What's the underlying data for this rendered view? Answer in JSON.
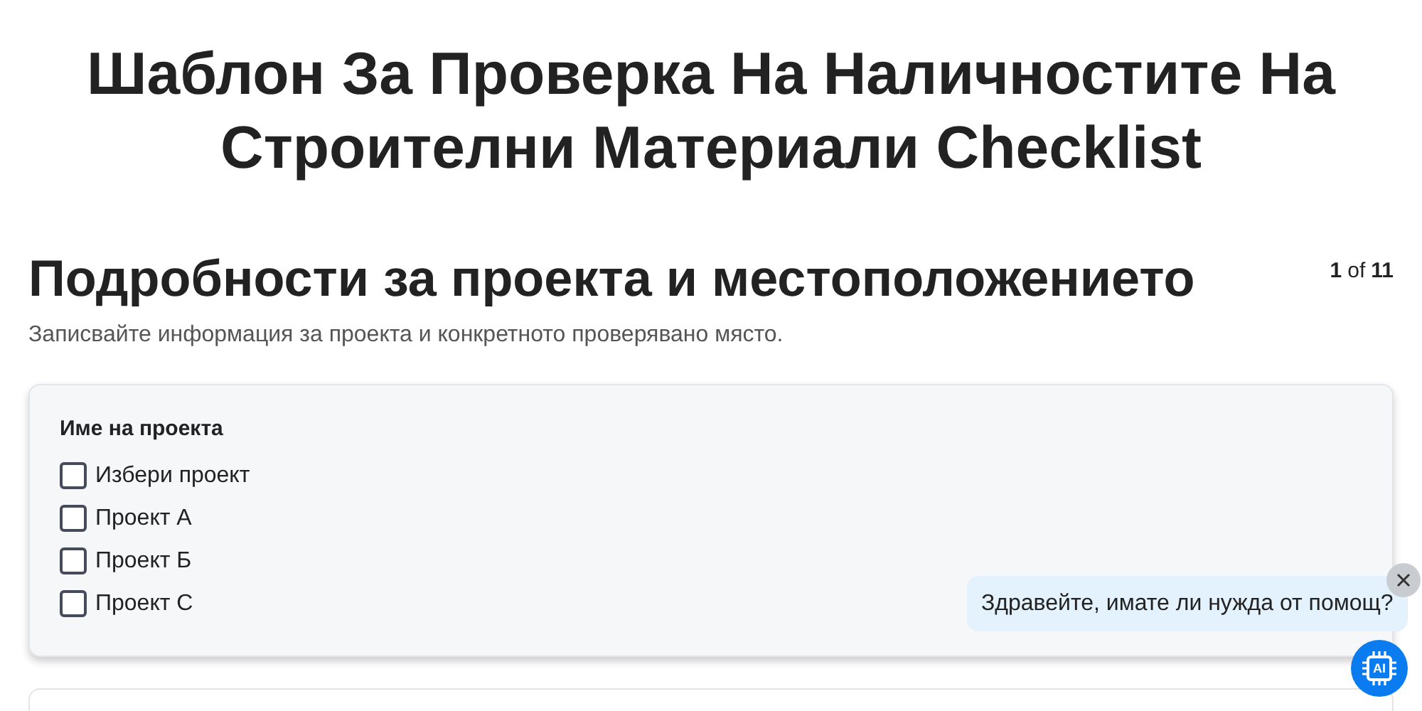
{
  "title": "Шаблон За Проверка На Наличностите На Строителни Материали Checklist",
  "section": {
    "heading": "Подробности за проекта и местоположението",
    "page_current": "1",
    "page_of": "of",
    "page_total": "11",
    "description": "Записвайте информация за проекта и конкретното проверявано място."
  },
  "question": {
    "label": "Име на проекта",
    "options": [
      {
        "label": "Избери проект",
        "checked": false
      },
      {
        "label": "Проект А",
        "checked": false
      },
      {
        "label": "Проект Б",
        "checked": false
      },
      {
        "label": "Проект С",
        "checked": false
      }
    ]
  },
  "chat": {
    "message": "Здравейте, имате ли нужда от помощ?",
    "button_label": "AI"
  }
}
